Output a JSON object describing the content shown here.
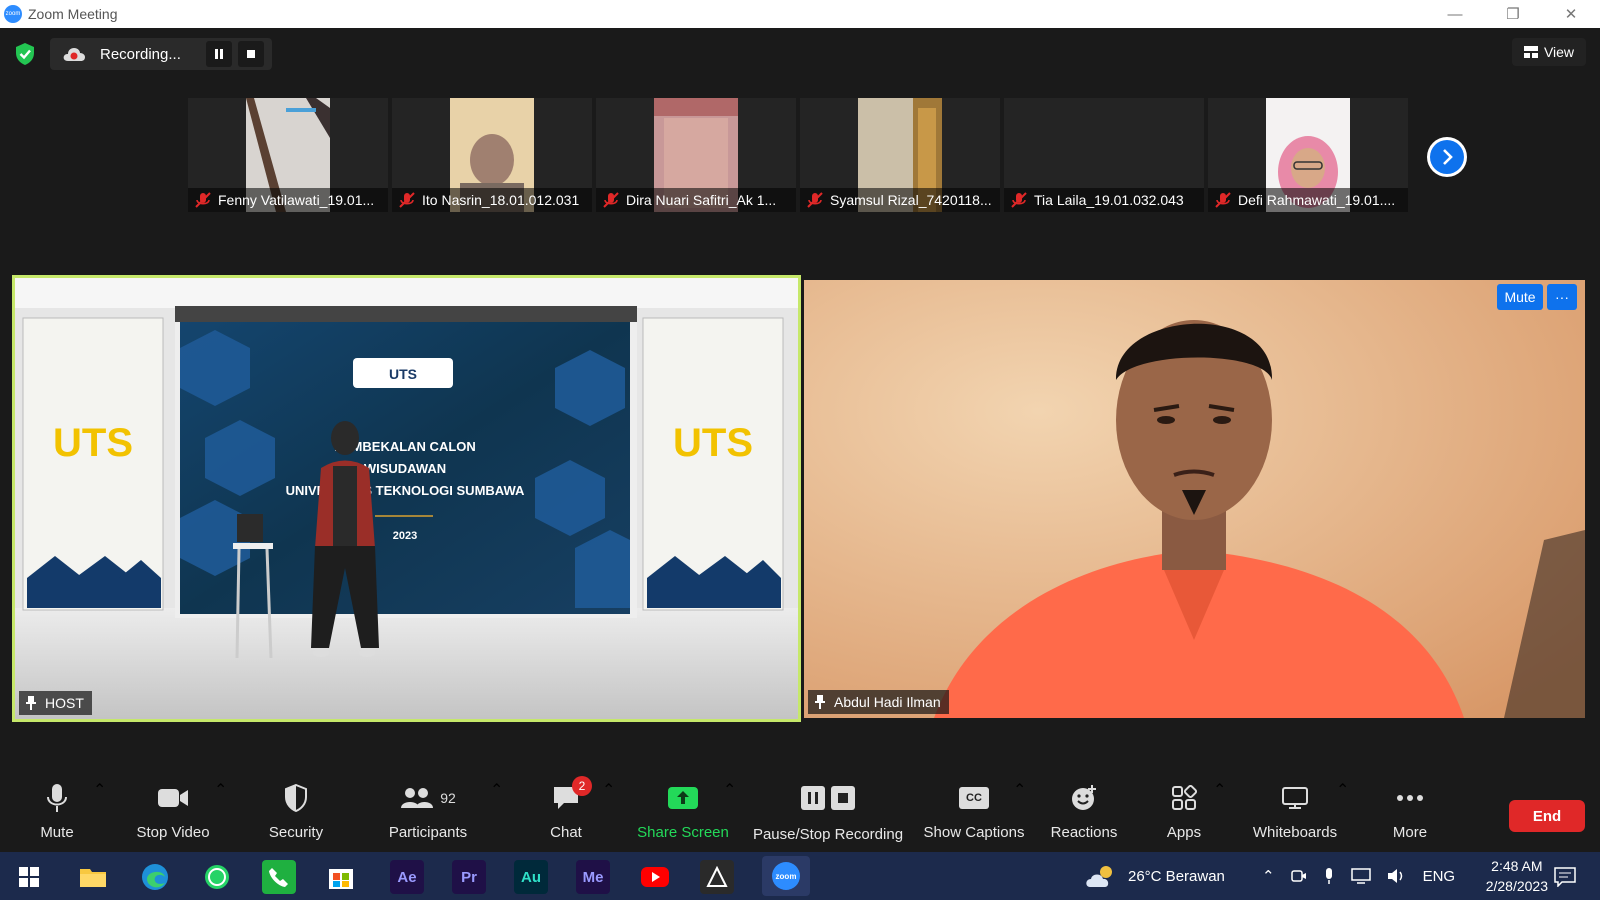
{
  "window": {
    "title": "Zoom Meeting",
    "logo_text": "zoom"
  },
  "meeting_bar": {
    "recording_label": "Recording...",
    "view_label": "View"
  },
  "thumbnails": [
    {
      "name": "Fenny Vatilawati_19.01..."
    },
    {
      "name": "Ito Nasrin_18.01.012.031"
    },
    {
      "name": "Dira Nuari Safitri_Ak 1..."
    },
    {
      "name": "Syamsul Rizal_7420118..."
    },
    {
      "name": "Tia Laila_19.01.032.043"
    },
    {
      "name": "Defi Rahmawati_19.01...."
    }
  ],
  "main_tiles": {
    "left": {
      "name": "HOST",
      "stage": {
        "logo_text": "UTS",
        "logo_sub": "UNIVERSITAS TEKNOLOGI SUMBAWA",
        "banner_line1": "PEMBEKALAN CALON",
        "banner_line2": "WISUDAWAN",
        "banner_line3": "UNIVERSITAS TEKNOLOGI SUMBAWA",
        "banner_year": "2023"
      }
    },
    "right": {
      "name": "Abdul Hadi Ilman",
      "mute_label": "Mute",
      "more_label": "···"
    }
  },
  "toolbar": {
    "mute": "Mute",
    "stop_video": "Stop Video",
    "security": "Security",
    "participants": "Participants",
    "participants_count": "92",
    "chat": "Chat",
    "chat_badge": "2",
    "share_screen": "Share Screen",
    "pause_stop_recording": "Pause/Stop Recording",
    "show_captions": "Show Captions",
    "captions_icon": "CC",
    "reactions": "Reactions",
    "apps": "Apps",
    "whiteboards": "Whiteboards",
    "more": "More",
    "end": "End"
  },
  "taskbar": {
    "apps": [
      "Ae",
      "Pr",
      "Au",
      "Me"
    ],
    "weather": "26°C  Berawan",
    "language": "ENG",
    "time": "2:48 AM",
    "date": "2/28/2023",
    "zoom_label": "zoom"
  },
  "colors": {
    "accent": "#0e72ed",
    "end_red": "#e02828",
    "active_speaker_border": "#c6e86a",
    "share_green": "#23d959"
  }
}
